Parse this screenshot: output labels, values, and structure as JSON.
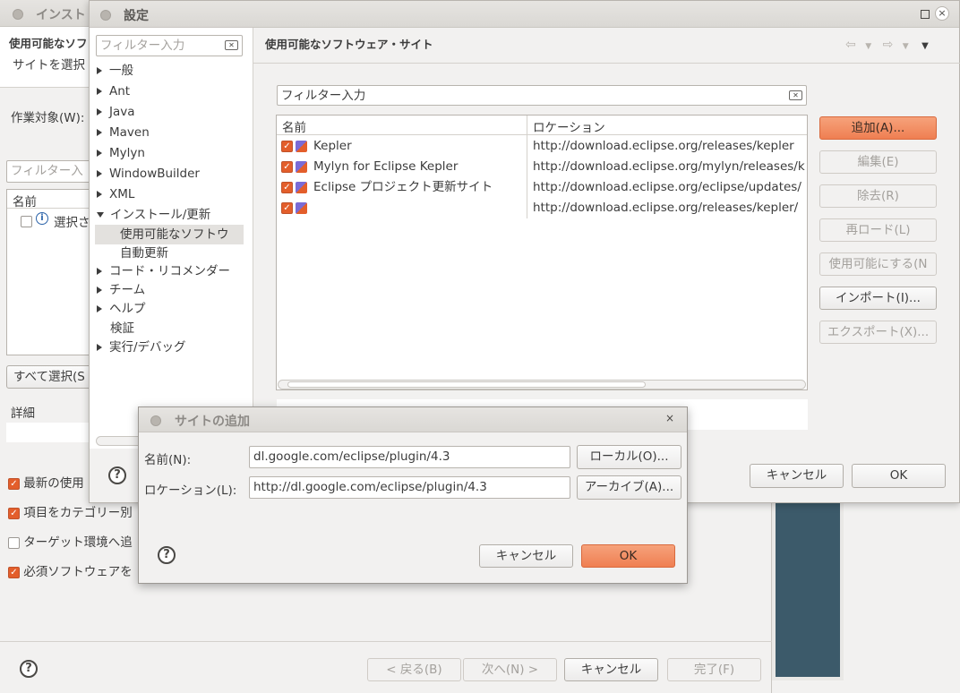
{
  "back_window": {
    "title": "インスト",
    "heading": "使用可能なソフ",
    "subheading": "サイトを選択",
    "work_label": "作業対象(W):",
    "filter_placeholder": "フィルター入",
    "col_name": "名前",
    "row_text": "選択さ",
    "select_all": "すべて選択(S",
    "details_label": "詳細",
    "options": [
      {
        "label": "最新の使用",
        "checked": true
      },
      {
        "label": "項目をカテゴリー別",
        "checked": true
      },
      {
        "label": "ターゲット環境へ追",
        "checked": false
      },
      {
        "label": "必須ソフトウェアを",
        "checked": true
      }
    ],
    "buttons": {
      "back": "< 戻る(B)",
      "next": "次へ(N) >",
      "cancel": "キャンセル",
      "finish": "完了(F)"
    }
  },
  "settings": {
    "title": "設定",
    "filter_placeholder": "フィルター入力",
    "tree": [
      {
        "label": "一般",
        "state": "collapsed"
      },
      {
        "label": "Ant",
        "state": "collapsed"
      },
      {
        "label": "Java",
        "state": "collapsed"
      },
      {
        "label": "Maven",
        "state": "collapsed"
      },
      {
        "label": "Mylyn",
        "state": "collapsed"
      },
      {
        "label": "WindowBuilder",
        "state": "collapsed"
      },
      {
        "label": "XML",
        "state": "collapsed"
      },
      {
        "label": "インストール/更新",
        "state": "expanded"
      },
      {
        "label": "使用可能なソフトウ",
        "state": "child-selected"
      },
      {
        "label": "自動更新",
        "state": "child"
      },
      {
        "label": "コード・リコメンダー",
        "state": "collapsed"
      },
      {
        "label": "チーム",
        "state": "collapsed"
      },
      {
        "label": "ヘルプ",
        "state": "collapsed"
      },
      {
        "label": "検証",
        "state": "leaf"
      },
      {
        "label": "実行/デバッグ",
        "state": "collapsed"
      }
    ],
    "page_title": "使用可能なソフトウェア・サイト",
    "site_filter_placeholder": "フィルター入力",
    "columns": {
      "name": "名前",
      "location": "ロケーション"
    },
    "sites": [
      {
        "name": "Kepler",
        "location": "http://download.eclipse.org/releases/kepler",
        "checked": true
      },
      {
        "name": "Mylyn for Eclipse Kepler",
        "location": "http://download.eclipse.org/mylyn/releases/k",
        "checked": true
      },
      {
        "name": "Eclipse プロジェクト更新サイト",
        "location": "http://download.eclipse.org/eclipse/updates/",
        "checked": true
      },
      {
        "name": "",
        "location": "http://download.eclipse.org/releases/kepler/",
        "checked": true
      }
    ],
    "side_buttons": [
      {
        "label": "追加(A)...",
        "style": "primary"
      },
      {
        "label": "編集(E)",
        "style": "disabled"
      },
      {
        "label": "除去(R)",
        "style": "disabled"
      },
      {
        "label": "再ロード(L)",
        "style": "disabled"
      },
      {
        "label": "使用可能にする(N",
        "style": "disabled"
      },
      {
        "label": "インポート(I)...",
        "style": "normal"
      },
      {
        "label": "エクスポート(X)...",
        "style": "disabled"
      }
    ],
    "cancel": "キャンセル",
    "ok": "OK"
  },
  "add_site": {
    "title": "サイトの追加",
    "name_label": "名前(N):",
    "name_value": "dl.google.com/eclipse/plugin/4.3",
    "location_label": "ロケーション(L):",
    "location_value": "http://dl.google.com/eclipse/plugin/4.3",
    "local_button": "ローカル(O)...",
    "archive_button": "アーカイブ(A)...",
    "cancel": "キャンセル",
    "ok": "OK"
  },
  "colors": {
    "accent": "#ef7f52",
    "window_bg": "#f2f1f0",
    "dark_panel": "#3c5a6a"
  }
}
